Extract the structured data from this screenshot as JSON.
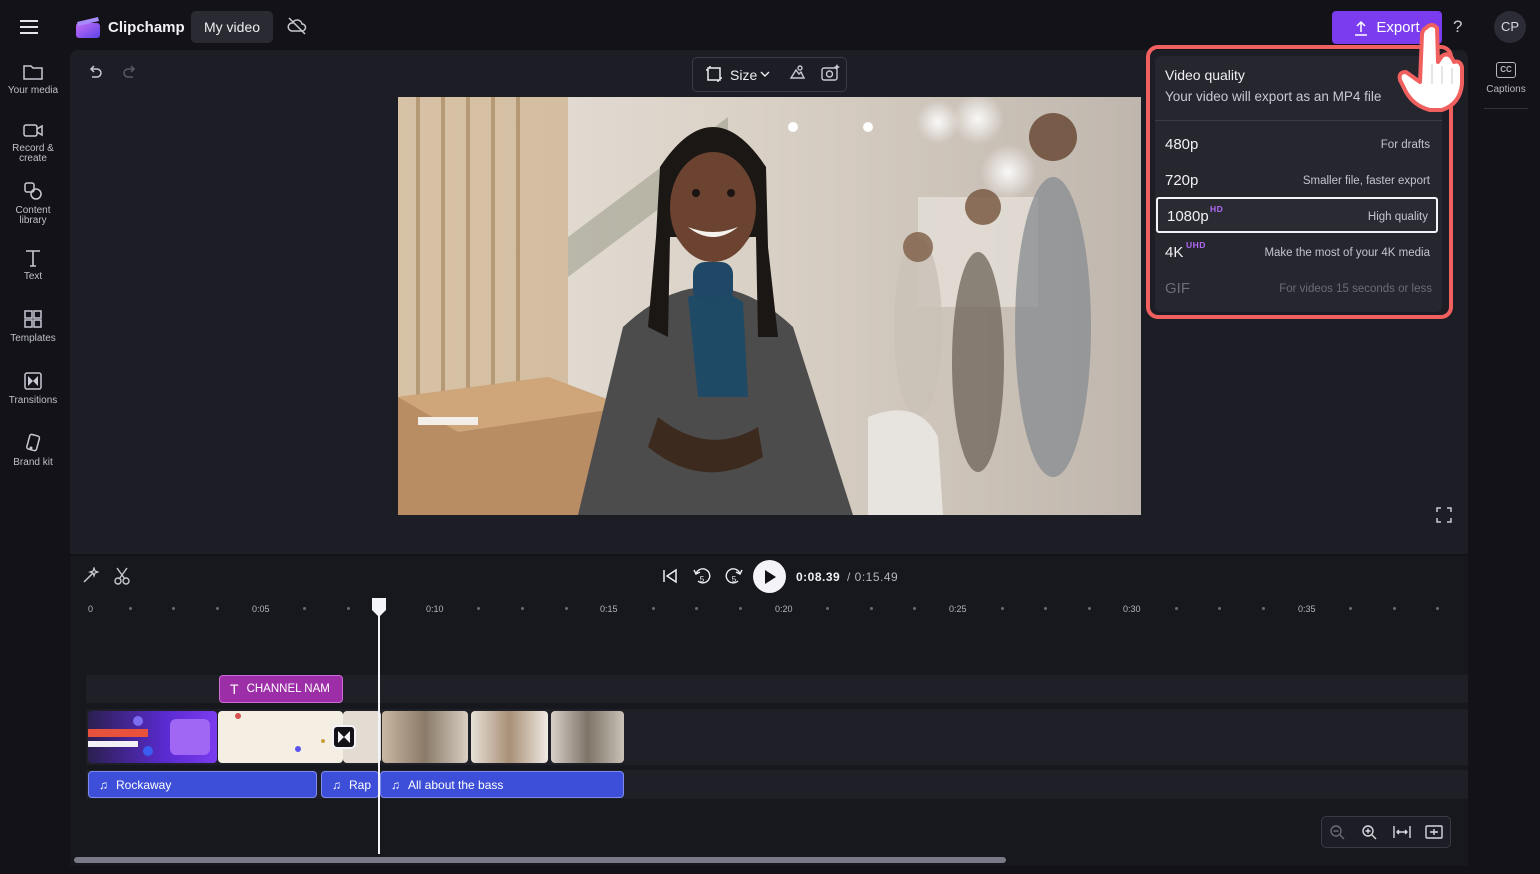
{
  "app": {
    "brand": "Clipchamp",
    "project_name": "My video",
    "export_label": "Export",
    "help_label": "?",
    "avatar_initials": "CP",
    "accent_color": "#7b3cf0"
  },
  "left_rail": {
    "items": [
      {
        "label_line1": "Your media",
        "label_line2": "",
        "icon": "folder-icon"
      },
      {
        "label_line1": "Record &",
        "label_line2": "create",
        "icon": "camera-icon"
      },
      {
        "label_line1": "Content",
        "label_line2": "library",
        "icon": "shapes-icon"
      },
      {
        "label_line1": "Text",
        "label_line2": "",
        "icon": "text-icon"
      },
      {
        "label_line1": "Templates",
        "label_line2": "",
        "icon": "templates-icon"
      },
      {
        "label_line1": "Transitions",
        "label_line2": "",
        "icon": "transitions-icon"
      },
      {
        "label_line1": "Brand kit",
        "label_line2": "",
        "icon": "brand-kit-icon"
      }
    ]
  },
  "right_rail": {
    "captions_badge": "CC",
    "captions_label": "Captions"
  },
  "canvas_toolbar": {
    "size_label": "Size"
  },
  "export_menu": {
    "title": "Video quality",
    "subtitle": "Your video will export as an MP4 file",
    "options": [
      {
        "name": "480p",
        "badge": "",
        "description": "For drafts",
        "selected": false,
        "disabled": false
      },
      {
        "name": "720p",
        "badge": "",
        "description": "Smaller file, faster export",
        "selected": false,
        "disabled": false
      },
      {
        "name": "1080p",
        "badge": "HD",
        "description": "High quality",
        "selected": true,
        "disabled": false
      },
      {
        "name": "4K",
        "badge": "UHD",
        "description": "Make the most of your 4K media",
        "selected": false,
        "disabled": false
      },
      {
        "name": "GIF",
        "badge": "",
        "description": "For videos 15 seconds or less",
        "selected": false,
        "disabled": true
      }
    ],
    "highlight_color": "#f0605e"
  },
  "playback": {
    "current_time": "0:08.39",
    "total_time": "/ 0:15.49",
    "rewind_seconds": "5",
    "forward_seconds": "5"
  },
  "ruler": {
    "labels": [
      "0",
      "0:05",
      "0:10",
      "0:15",
      "0:20",
      "0:25",
      "0:30",
      "0:35"
    ]
  },
  "tracks": {
    "text_clip": "CHANNEL NAM",
    "audio_clips": [
      "Rockaway",
      "Rap",
      "All about the bass"
    ]
  }
}
